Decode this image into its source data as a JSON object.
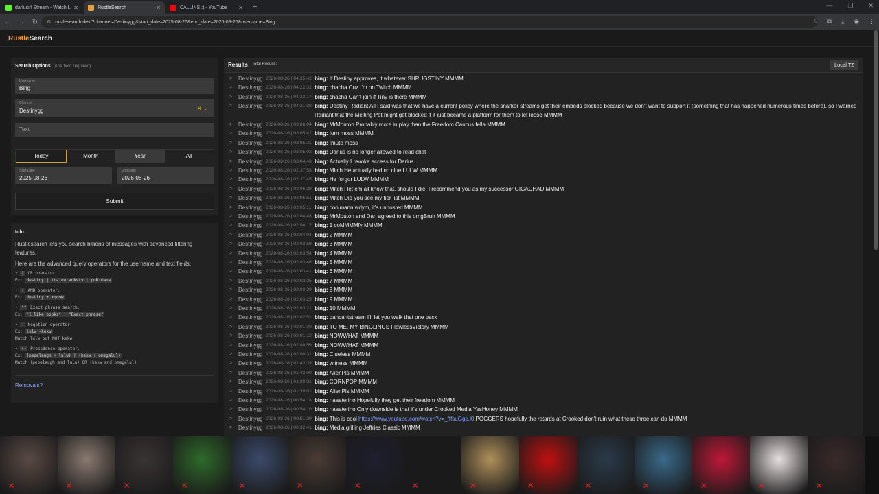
{
  "browser": {
    "tabs": [
      {
        "label": "darlusirl Stream - Watch Live o",
        "favicon_color": "#53fc18",
        "active": false
      },
      {
        "label": "RustleSearch",
        "favicon_color": "#e8a03a",
        "active": true
      },
      {
        "label": "CALLINS :) - YouTube",
        "favicon_color": "#ff0000",
        "active": false
      }
    ],
    "new_tab": "+",
    "url": "rustlesearch.dev/?channel=Destinygg&start_date=2025-08-26&end_date=2026-08-26&username=Bing"
  },
  "site": {
    "logo_part1": "Rustle",
    "logo_part2": "Search"
  },
  "search": {
    "title": "Search Options",
    "subtitle": "(one field required)",
    "username_label": "Username",
    "username_value": "Bing",
    "channel_label": "Channel",
    "channel_value": "Destinygg",
    "text_placeholder": "Text",
    "ranges": [
      "Today",
      "Month",
      "Year",
      "All"
    ],
    "start_label": "Start Date",
    "start_value": "2025-08-26",
    "end_label": "End Date",
    "end_value": "2026-08-26",
    "submit": "Submit"
  },
  "info": {
    "title": "Info",
    "desc": "Rustlesearch lets you search billions of messages with advanced filtering features.",
    "ops_intro": "Here are the advanced query operators for the username and text fields:",
    "operators": [
      {
        "sym": "|",
        "name": "OR operator.",
        "ex": "destiny | trainwreckstv | pokimane",
        "note": ""
      },
      {
        "sym": "+",
        "name": "AND operator.",
        "ex": "destiny + xqcow",
        "note": ""
      },
      {
        "sym": "\"\"",
        "name": "Exact phrase search.",
        "ex": "\"I like books\" | \"Exact phrase\"",
        "note": ""
      },
      {
        "sym": "-",
        "name": "Negation operator.",
        "ex": "lulw -kekw",
        "note": "Match lulw but NOT kekw"
      },
      {
        "sym": "()",
        "name": "Precedence operator.",
        "ex": "(pepelaugh + lulw) | (kekw + omegalul)",
        "note": "Match (pepelaugh and lulw) OR (kekw and omegalul)"
      }
    ],
    "ex_prefix": "Ex:",
    "removals": "Removals?"
  },
  "results": {
    "title": "Results",
    "total_label": "Total Results:",
    "tz_button": "Local TZ",
    "expand_glyph": ">",
    "messages": [
      {
        "channel": "Destinygg",
        "ts": "2026-08-26 | 04:35:42",
        "user": "bing:",
        "text": "If Destiny approves, it whatever SHRUGSTINY MMMM"
      },
      {
        "channel": "Destinygg",
        "ts": "2026-08-26 | 04:22:31",
        "user": "bing:",
        "text": "chacha Cuz I'm on Twitch MMMM"
      },
      {
        "channel": "Destinygg",
        "ts": "2026-08-26 | 04:22:17",
        "user": "bing:",
        "text": "chacha Can't join if Tiny is there MMMM"
      },
      {
        "channel": "Destinygg",
        "ts": "2026-08-26 | 04:21:38",
        "user": "bing:",
        "text": "Destiny Radiant All I said was that we have a current policy where the snarker streams get their embeds blocked because we don't want to support it (something that has happened numerous times before), so I warned Radiant that the Melting Pot might get blocked if it just became a platform for them to let loose MMMM",
        "lines": 2
      },
      {
        "channel": "Destinygg",
        "ts": "2026-08-26 | 03:06:04",
        "user": "bing:",
        "text": "MrMouton Probably more in play than the Freedom Caucus fella MMMM"
      },
      {
        "channel": "Destinygg",
        "ts": "2026-08-26 | 03:05:42",
        "user": "bing:",
        "text": "!urn moss MMMM"
      },
      {
        "channel": "Destinygg",
        "ts": "2026-08-26 | 03:05:21",
        "user": "bing:",
        "text": "!mute moss"
      },
      {
        "channel": "Destinygg",
        "ts": "2026-08-26 | 03:05:02",
        "user": "bing:",
        "text": "Darius is no longer allowed to read chat"
      },
      {
        "channel": "Destinygg",
        "ts": "2026-08-26 | 03:04:43",
        "user": "bing:",
        "text": "Actually I revoke access for Darius"
      },
      {
        "channel": "Destinygg",
        "ts": "2026-08-26 | 02:37:53",
        "user": "bing:",
        "text": "Mitch He actually had no clue LULW MMMM"
      },
      {
        "channel": "Destinygg",
        "ts": "2026-08-26 | 02:37:45",
        "user": "bing:",
        "text": "He forgor LULW MMMM"
      },
      {
        "channel": "Destinygg",
        "ts": "2026-08-26 | 02:06:29",
        "user": "bing:",
        "text": "Mitch I let em all know that, should I die, I recommend you as my successor GIGACHAD MMMM"
      },
      {
        "channel": "Destinygg",
        "ts": "2026-08-26 | 02:05:51",
        "user": "bing:",
        "text": "Mitch Did you see my tier list MMMM"
      },
      {
        "channel": "Destinygg",
        "ts": "2026-08-26 | 02:05:11",
        "user": "bing:",
        "text": "coolmann wdym, it's unhosted MMMM"
      },
      {
        "channel": "Destinygg",
        "ts": "2026-08-26 | 02:04:48",
        "user": "bing:",
        "text": "MrMouton and Dan agreed to this omgBruh MMMM"
      },
      {
        "channel": "Destinygg",
        "ts": "2026-08-26 | 02:04:12",
        "user": "bing:",
        "text": "1 coMMMMfy MMMM"
      },
      {
        "channel": "Destinygg",
        "ts": "2026-08-26 | 02:04:04",
        "user": "bing:",
        "text": "2 MMMM"
      },
      {
        "channel": "Destinygg",
        "ts": "2026-08-26 | 02:03:59",
        "user": "bing:",
        "text": "3 MMMM"
      },
      {
        "channel": "Destinygg",
        "ts": "2026-08-26 | 02:03:54",
        "user": "bing:",
        "text": "4 MMMM"
      },
      {
        "channel": "Destinygg",
        "ts": "2026-08-26 | 02:03:46",
        "user": "bing:",
        "text": "5 MMMM"
      },
      {
        "channel": "Destinygg",
        "ts": "2026-08-26 | 02:03:41",
        "user": "bing:",
        "text": "6 MMMM"
      },
      {
        "channel": "Destinygg",
        "ts": "2026-08-26 | 02:03:35",
        "user": "bing:",
        "text": "7 MMMM"
      },
      {
        "channel": "Destinygg",
        "ts": "2026-08-26 | 02:03:29",
        "user": "bing:",
        "text": "8 MMMM"
      },
      {
        "channel": "Destinygg",
        "ts": "2026-08-26 | 02:03:25",
        "user": "bing:",
        "text": "9 MMMM"
      },
      {
        "channel": "Destinygg",
        "ts": "2026-08-26 | 02:03:21",
        "user": "bing:",
        "text": "10 MMMM"
      },
      {
        "channel": "Destinygg",
        "ts": "2026-08-26 | 02:02:51",
        "user": "bing:",
        "text": "dancantstream I'll let you walk that one back"
      },
      {
        "channel": "Destinygg",
        "ts": "2026-08-26 | 02:01:30",
        "user": "bing:",
        "text": "TO ME, MY BINGLINGS FlawlessVictory MMMM"
      },
      {
        "channel": "Destinygg",
        "ts": "2026-08-26 | 02:01:12",
        "user": "bing:",
        "text": "NOWWHAT MMMM"
      },
      {
        "channel": "Destinygg",
        "ts": "2026-08-26 | 02:00:59",
        "user": "bing:",
        "text": "NOWWHAT MMMM"
      },
      {
        "channel": "Destinygg",
        "ts": "2026-08-26 | 02:00:31",
        "user": "bing:",
        "text": "Clueless MMMM"
      },
      {
        "channel": "Destinygg",
        "ts": "2026-08-26 | 01:43:39",
        "user": "bing:",
        "text": "witness MMMM"
      },
      {
        "channel": "Destinygg",
        "ts": "2026-08-26 | 01:43:00",
        "user": "bing:",
        "text": "AlienPls MMMM"
      },
      {
        "channel": "Destinygg",
        "ts": "2026-08-26 | 01:39:31",
        "user": "bing:",
        "text": "CORNPOP MMMM"
      },
      {
        "channel": "Destinygg",
        "ts": "2026-08-26 | 01:39:01",
        "user": "bing:",
        "text": "AlienPls MMMM"
      },
      {
        "channel": "Destinygg",
        "ts": "2026-08-26 | 00:54:18",
        "user": "bing:",
        "text": "naaaterino Hopefully they get their freedom MMMM"
      },
      {
        "channel": "Destinygg",
        "ts": "2026-08-26 | 00:54:10",
        "user": "bing:",
        "text": "naaaterino Only downside is that it's under Crooked Media YesHoney MMMM"
      },
      {
        "channel": "Destinygg",
        "ts": "2026-08-26 | 00:51:39",
        "user": "bing:",
        "text": "This is cool ",
        "link": "https://www.youtube.com/watch?v=_ftfsuGge.l0",
        "after": " POGGERS hopefully the retards at Crooked don't ruin what these three can do MMMM"
      },
      {
        "channel": "Destinygg",
        "ts": "2026-08-26 | 00:32:41",
        "user": "bing:",
        "text": "Media grilling Jeffries Classic MMMM"
      }
    ]
  },
  "overlay": {
    "thumb_colors": [
      "#5a4a44",
      "#8a7a70",
      "#3a3434",
      "#2e6a2a",
      "#3b4a6a",
      "#4a3c34",
      "#1e1e2e",
      "#1a1a1a",
      "#b0905a",
      "#c01010",
      "#2a3a4a",
      "#3a6a8a",
      "#c01838",
      "#e8e0e0",
      "#3a2a2a"
    ]
  }
}
